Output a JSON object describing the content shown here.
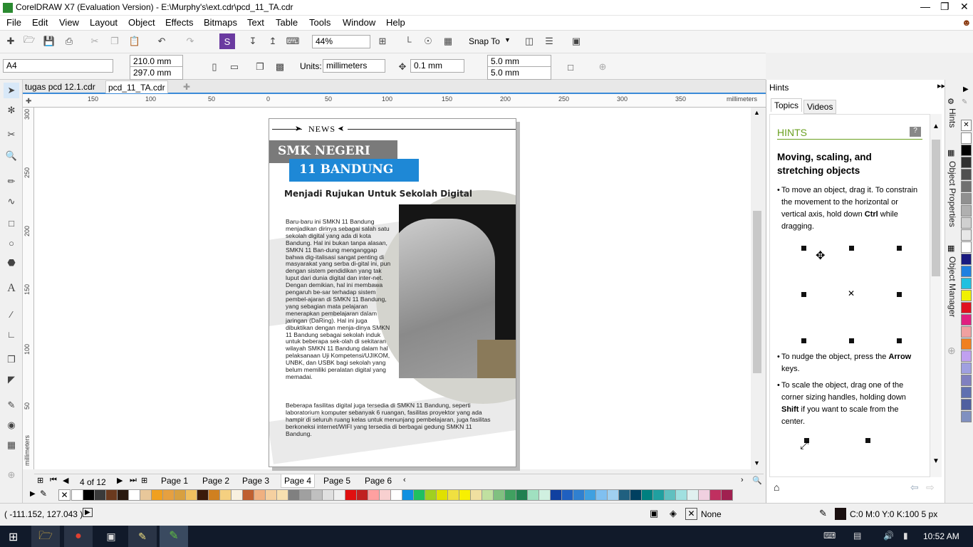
{
  "window": {
    "title": "CorelDRAW X7 (Evaluation Version) - E:\\Murphy's\\ext.cdr\\pcd_11_TA.cdr"
  },
  "menu": [
    "File",
    "Edit",
    "View",
    "Layout",
    "Object",
    "Effects",
    "Bitmaps",
    "Text",
    "Table",
    "Tools",
    "Window",
    "Help"
  ],
  "toolbar": {
    "zoom": "44%",
    "snap_to": "Snap To"
  },
  "propbar": {
    "page_size": "A4",
    "width": "210.0 mm",
    "height": "297.0 mm",
    "units_label": "Units:",
    "units": "millimeters",
    "nudge": "0.1 mm",
    "dup_x": "5.0 mm",
    "dup_y": "5.0 mm"
  },
  "doc_tabs": [
    "tugas pcd 12.1.cdr",
    "pcd_11_TA.cdr"
  ],
  "ruler": {
    "unit": "millimeters",
    "h_ticks": [
      "150",
      "100",
      "50",
      "0",
      "50",
      "100",
      "150",
      "200",
      "250",
      "300",
      "350"
    ],
    "v_ticks": [
      "300",
      "250",
      "200",
      "150",
      "100",
      "50"
    ]
  },
  "document": {
    "news": "NEWS",
    "school_line1": "SMK NEGERI",
    "school_line2": "11 BANDUNG",
    "headline": "Menjadi Rujukan Untuk Sekolah Digital",
    "body": "Baru-baru ini SMKN 11 Bandung menjadikan dirinya sebagai salah satu sekolah digital yang ada di kota Bandung. Hal ini bukan tanpa alasan, SMKN 11 Ban-dung menganggap bahwa dig-italisasi sangat penting di masyarakat yang serba di-gital ini, pun dengan sistem pendidikan yang tak luput dari dunia digital dan inter-net. Dengan demikian, hal ini membawa pengaruh be-sar terhadap sistem pembel-ajaran di SMKN 11 Bandung, yang sebagian mata pelajaran menerapkan pembelajaran dalam jaringan (DaRing). Hal ini juga dibuktikan dengan menja-dinya SMKN 11 Bandung sebagai sekolah induk untuk beberapa sek-olah di sekitaran wilayah SMKN 11 Bandung dalam hal pelaksanaan Uji Kompetensi/UJIKOM, UNBK, dan USBK bagi sekolah yang belum memiliki peralatan digital yang memadai.",
    "body2": "Beberapa fasilitas digital juga tersedia di SMKN 11 Bandung, seperti laboratorium komputer sebanyak 6 ruangan, fasilitas proyektor yang ada hampir di seluruh ruang kelas untuk menunjang pembelajaran, juga fasilitas berkoneksi internet/WIFI yang tersedia di berbagai gedung SMKN 11 Bandung."
  },
  "pager": {
    "label": "4 of 12",
    "pages": [
      "Page 1",
      "Page 2",
      "Page 3",
      "Page 4",
      "Page 5",
      "Page 6"
    ],
    "active": 3
  },
  "status": {
    "coords": "( -111.152, 127.043 )",
    "fill": "None",
    "outline": "C:0 M:0 Y:0 K:100  5 px"
  },
  "docker": {
    "title": "Hints",
    "tab_topics": "Topics",
    "tab_videos": "Videos",
    "section": "HINTS",
    "heading": "Moving, scaling, and stretching objects",
    "p1_a": "To move an object, drag it. To constrain the movement to the horizontal or vertical axis, hold down ",
    "p1_b": "Ctrl",
    "p1_c": " while dragging.",
    "p2_a": "To nudge the object, press the ",
    "p2_b": "Arrow",
    "p2_c": " keys.",
    "p3_a": "To scale the object, drag one of the corner sizing handles, holding down ",
    "p3_b": "Shift",
    "p3_c": " if you want to scale from the center.",
    "side_tabs": [
      "Hints",
      "Object Properties",
      "Object Manager"
    ]
  },
  "taskbar": {
    "time": "10:52 AM"
  },
  "colors": {
    "accent": "#3a8ad8",
    "news_blue": "#1e88d6",
    "dark_label": "#7a7a7a",
    "taskbar": "#111a2a"
  },
  "palette": [
    "#ffffff",
    "#000000",
    "#3a3a3a",
    "#6b3a1e",
    "#2a1a10",
    "#ffffff",
    "#e8c79a",
    "#f0a020",
    "#e6a040",
    "#d8a040",
    "#f0c060",
    "#3a1a0a",
    "#d08020",
    "#f5d080",
    "#f8f0e0",
    "#c06030",
    "#f0b080",
    "#f5d0a0",
    "#f8e0b0",
    "#808080",
    "#a0a0a0",
    "#c0c0c0",
    "#e0e0e0",
    "#f0f0f0",
    "#e01010",
    "#c02020",
    "#ffa0a0",
    "#f8d0d0",
    "#ffffff",
    "#1090e0",
    "#20c060",
    "#a0d020",
    "#e0e000",
    "#f0e040",
    "#f8f000",
    "#f0e0a0",
    "#c0e0a0",
    "#80c080",
    "#40a060",
    "#208050",
    "#a0e0c0",
    "#d0f0e0",
    "#1040a0",
    "#2060c0",
    "#3080d0",
    "#40a0e0",
    "#80c0f0",
    "#a0d0f0",
    "#206080",
    "#004060",
    "#008080",
    "#20a0a0",
    "#60c0c0",
    "#a0e0e0",
    "#e0f0f0",
    "#f0d0e0",
    "#c03060",
    "#a02050"
  ],
  "rightpal": [
    "#ffffff",
    "#000000",
    "#303030",
    "#505050",
    "#707070",
    "#909090",
    "#b0b0b0",
    "#d0d0d0",
    "#e8e8e8",
    "#ffffff",
    "#1a1a80",
    "#2080e0",
    "#20c0e0",
    "#f0f000",
    "#e01020",
    "#e02080",
    "#f0a0a0",
    "#f08020",
    "#c0a0f0",
    "#a0a0e0",
    "#8080c0",
    "#6070b0",
    "#5060a0",
    "#8090c0"
  ]
}
